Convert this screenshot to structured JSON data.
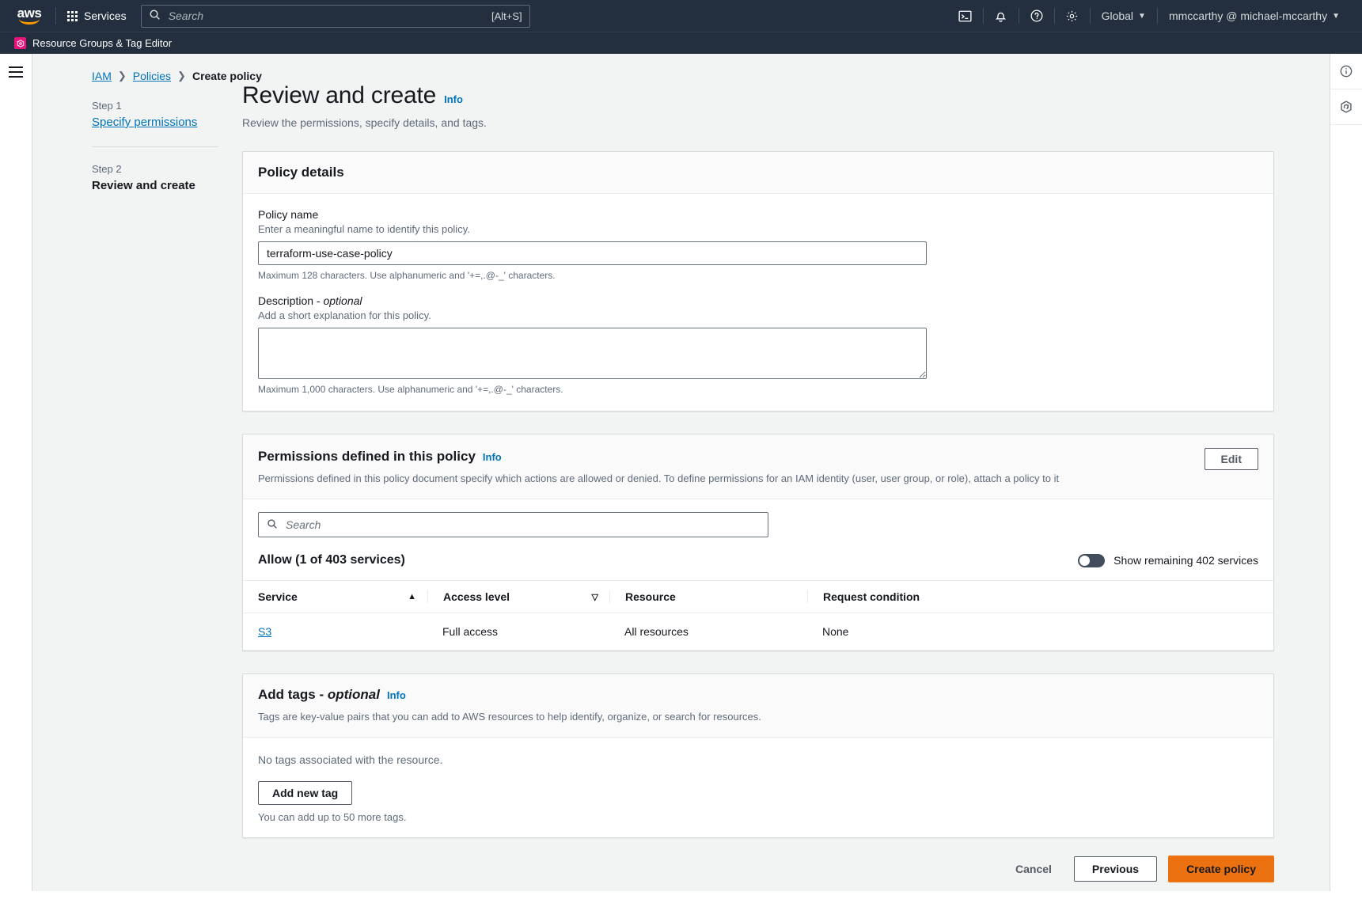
{
  "topnav": {
    "logo_text": "aws",
    "services_label": "Services",
    "search_placeholder": "Search",
    "search_value": "",
    "search_shortcut": "[Alt+S]",
    "icons": [
      "cloudshell-icon",
      "bell-icon",
      "help-icon",
      "settings-icon"
    ],
    "region_label": "Global",
    "account_label": "mmccarthy @ michael-mccarthy"
  },
  "servicebar": {
    "service_name": "Resource Groups & Tag Editor"
  },
  "breadcrumb": {
    "items": [
      "IAM",
      "Policies",
      "Create policy"
    ]
  },
  "steps": [
    {
      "step": "Step 1",
      "label": "Specify permissions",
      "active": false
    },
    {
      "step": "Step 2",
      "label": "Review and create",
      "active": true
    }
  ],
  "page": {
    "title": "Review and create",
    "info": "Info",
    "subtitle": "Review the permissions, specify details, and tags."
  },
  "policy_details": {
    "title": "Policy details",
    "name_label": "Policy name",
    "name_hint": "Enter a meaningful name to identify this policy.",
    "name_value": "terraform-use-case-policy",
    "name_placeholder": "",
    "name_foot": "Maximum 128 characters. Use alphanumeric and '+=,.@-_' characters.",
    "desc_label": "Description - ",
    "desc_label_em": "optional",
    "desc_hint": "Add a short explanation for this policy.",
    "desc_value": "",
    "desc_placeholder": "",
    "desc_foot": "Maximum 1,000 characters. Use alphanumeric and '+=,.@-_' characters."
  },
  "permissions": {
    "title": "Permissions defined in this policy",
    "info": "Info",
    "description": "Permissions defined in this policy document specify which actions are allowed or denied. To define permissions for an IAM identity (user, user group, or role), attach a policy to it",
    "edit_label": "Edit",
    "search_placeholder": "Search",
    "search_value": "",
    "allow_title": "Allow (1 of 403 services)",
    "toggle_label": "Show remaining 402 services",
    "toggle_on": false,
    "columns": [
      "Service",
      "Access level",
      "Resource",
      "Request condition"
    ],
    "sort_asc_col": 0,
    "rows": [
      {
        "service": "S3",
        "access_level": "Full access",
        "resource": "All resources",
        "request_condition": "None"
      }
    ]
  },
  "tags": {
    "title": "Add tags - ",
    "title_em": "optional",
    "info": "Info",
    "description": "Tags are key-value pairs that you can add to AWS resources to help identify, organize, or search for resources.",
    "empty_text": "No tags associated with the resource.",
    "add_label": "Add new tag",
    "foot_text": "You can add up to 50 more tags."
  },
  "actions": {
    "cancel": "Cancel",
    "previous": "Previous",
    "create": "Create policy"
  },
  "right_rail": {
    "icons": [
      "info-circle-icon",
      "shield-icon"
    ]
  },
  "colors": {
    "nav_bg": "#232f3e",
    "accent_orange": "#ec7211",
    "link_blue": "#0073bb",
    "service_badge": "#e7157b"
  }
}
